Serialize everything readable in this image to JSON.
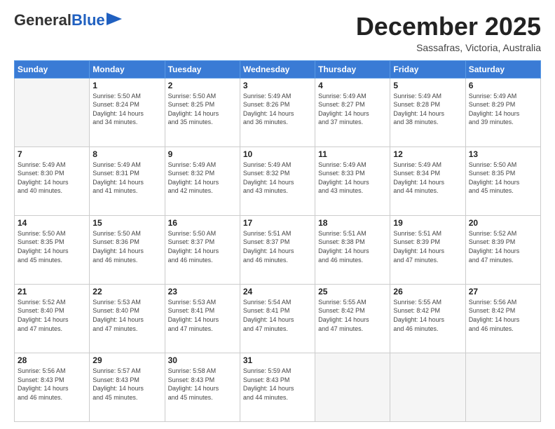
{
  "logo": {
    "line1": "General",
    "line2": "Blue"
  },
  "title": "December 2025",
  "subtitle": "Sassafras, Victoria, Australia",
  "header_days": [
    "Sunday",
    "Monday",
    "Tuesday",
    "Wednesday",
    "Thursday",
    "Friday",
    "Saturday"
  ],
  "weeks": [
    [
      {
        "day": "",
        "info": ""
      },
      {
        "day": "1",
        "info": "Sunrise: 5:50 AM\nSunset: 8:24 PM\nDaylight: 14 hours\nand 34 minutes."
      },
      {
        "day": "2",
        "info": "Sunrise: 5:50 AM\nSunset: 8:25 PM\nDaylight: 14 hours\nand 35 minutes."
      },
      {
        "day": "3",
        "info": "Sunrise: 5:49 AM\nSunset: 8:26 PM\nDaylight: 14 hours\nand 36 minutes."
      },
      {
        "day": "4",
        "info": "Sunrise: 5:49 AM\nSunset: 8:27 PM\nDaylight: 14 hours\nand 37 minutes."
      },
      {
        "day": "5",
        "info": "Sunrise: 5:49 AM\nSunset: 8:28 PM\nDaylight: 14 hours\nand 38 minutes."
      },
      {
        "day": "6",
        "info": "Sunrise: 5:49 AM\nSunset: 8:29 PM\nDaylight: 14 hours\nand 39 minutes."
      }
    ],
    [
      {
        "day": "7",
        "info": "Sunrise: 5:49 AM\nSunset: 8:30 PM\nDaylight: 14 hours\nand 40 minutes."
      },
      {
        "day": "8",
        "info": "Sunrise: 5:49 AM\nSunset: 8:31 PM\nDaylight: 14 hours\nand 41 minutes."
      },
      {
        "day": "9",
        "info": "Sunrise: 5:49 AM\nSunset: 8:32 PM\nDaylight: 14 hours\nand 42 minutes."
      },
      {
        "day": "10",
        "info": "Sunrise: 5:49 AM\nSunset: 8:32 PM\nDaylight: 14 hours\nand 43 minutes."
      },
      {
        "day": "11",
        "info": "Sunrise: 5:49 AM\nSunset: 8:33 PM\nDaylight: 14 hours\nand 43 minutes."
      },
      {
        "day": "12",
        "info": "Sunrise: 5:49 AM\nSunset: 8:34 PM\nDaylight: 14 hours\nand 44 minutes."
      },
      {
        "day": "13",
        "info": "Sunrise: 5:50 AM\nSunset: 8:35 PM\nDaylight: 14 hours\nand 45 minutes."
      }
    ],
    [
      {
        "day": "14",
        "info": "Sunrise: 5:50 AM\nSunset: 8:35 PM\nDaylight: 14 hours\nand 45 minutes."
      },
      {
        "day": "15",
        "info": "Sunrise: 5:50 AM\nSunset: 8:36 PM\nDaylight: 14 hours\nand 46 minutes."
      },
      {
        "day": "16",
        "info": "Sunrise: 5:50 AM\nSunset: 8:37 PM\nDaylight: 14 hours\nand 46 minutes."
      },
      {
        "day": "17",
        "info": "Sunrise: 5:51 AM\nSunset: 8:37 PM\nDaylight: 14 hours\nand 46 minutes."
      },
      {
        "day": "18",
        "info": "Sunrise: 5:51 AM\nSunset: 8:38 PM\nDaylight: 14 hours\nand 46 minutes."
      },
      {
        "day": "19",
        "info": "Sunrise: 5:51 AM\nSunset: 8:39 PM\nDaylight: 14 hours\nand 47 minutes."
      },
      {
        "day": "20",
        "info": "Sunrise: 5:52 AM\nSunset: 8:39 PM\nDaylight: 14 hours\nand 47 minutes."
      }
    ],
    [
      {
        "day": "21",
        "info": "Sunrise: 5:52 AM\nSunset: 8:40 PM\nDaylight: 14 hours\nand 47 minutes."
      },
      {
        "day": "22",
        "info": "Sunrise: 5:53 AM\nSunset: 8:40 PM\nDaylight: 14 hours\nand 47 minutes."
      },
      {
        "day": "23",
        "info": "Sunrise: 5:53 AM\nSunset: 8:41 PM\nDaylight: 14 hours\nand 47 minutes."
      },
      {
        "day": "24",
        "info": "Sunrise: 5:54 AM\nSunset: 8:41 PM\nDaylight: 14 hours\nand 47 minutes."
      },
      {
        "day": "25",
        "info": "Sunrise: 5:55 AM\nSunset: 8:42 PM\nDaylight: 14 hours\nand 47 minutes."
      },
      {
        "day": "26",
        "info": "Sunrise: 5:55 AM\nSunset: 8:42 PM\nDaylight: 14 hours\nand 46 minutes."
      },
      {
        "day": "27",
        "info": "Sunrise: 5:56 AM\nSunset: 8:42 PM\nDaylight: 14 hours\nand 46 minutes."
      }
    ],
    [
      {
        "day": "28",
        "info": "Sunrise: 5:56 AM\nSunset: 8:43 PM\nDaylight: 14 hours\nand 46 minutes."
      },
      {
        "day": "29",
        "info": "Sunrise: 5:57 AM\nSunset: 8:43 PM\nDaylight: 14 hours\nand 45 minutes."
      },
      {
        "day": "30",
        "info": "Sunrise: 5:58 AM\nSunset: 8:43 PM\nDaylight: 14 hours\nand 45 minutes."
      },
      {
        "day": "31",
        "info": "Sunrise: 5:59 AM\nSunset: 8:43 PM\nDaylight: 14 hours\nand 44 minutes."
      },
      {
        "day": "",
        "info": ""
      },
      {
        "day": "",
        "info": ""
      },
      {
        "day": "",
        "info": ""
      }
    ]
  ]
}
